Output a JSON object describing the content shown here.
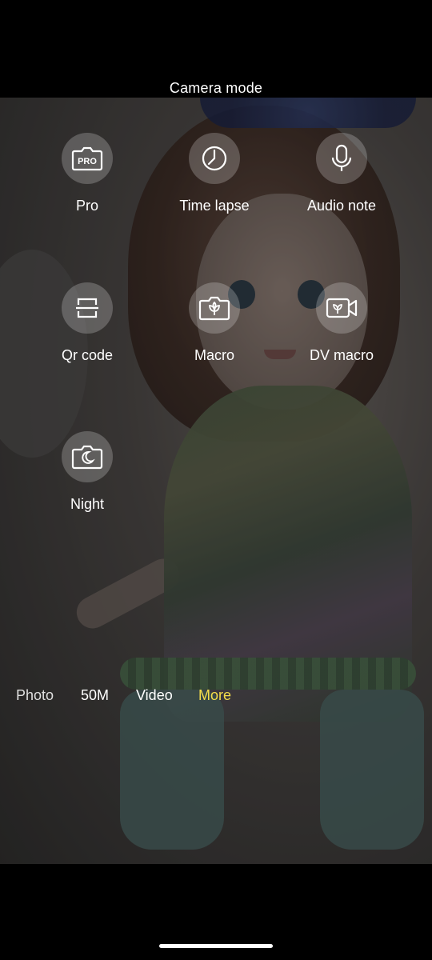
{
  "header": {
    "title": "Camera mode"
  },
  "modes": [
    {
      "id": "pro",
      "label": "Pro",
      "icon": "pro-camera-icon"
    },
    {
      "id": "time-lapse",
      "label": "Time lapse",
      "icon": "timer-icon"
    },
    {
      "id": "audio-note",
      "label": "Audio note",
      "icon": "microphone-icon"
    },
    {
      "id": "qr-code",
      "label": "Qr code",
      "icon": "qr-scan-icon"
    },
    {
      "id": "macro",
      "label": "Macro",
      "icon": "macro-camera-icon"
    },
    {
      "id": "dv-macro",
      "label": "DV macro",
      "icon": "video-macro-icon"
    },
    {
      "id": "night",
      "label": "Night",
      "icon": "night-camera-icon"
    }
  ],
  "mode_tabs": [
    {
      "label": "Photo"
    },
    {
      "label": "50M"
    },
    {
      "label": "Video"
    },
    {
      "label": "More",
      "active": true
    }
  ],
  "colors": {
    "active_tab": "#f4dc4b",
    "icon_bg": "rgba(255,255,255,0.22)"
  }
}
